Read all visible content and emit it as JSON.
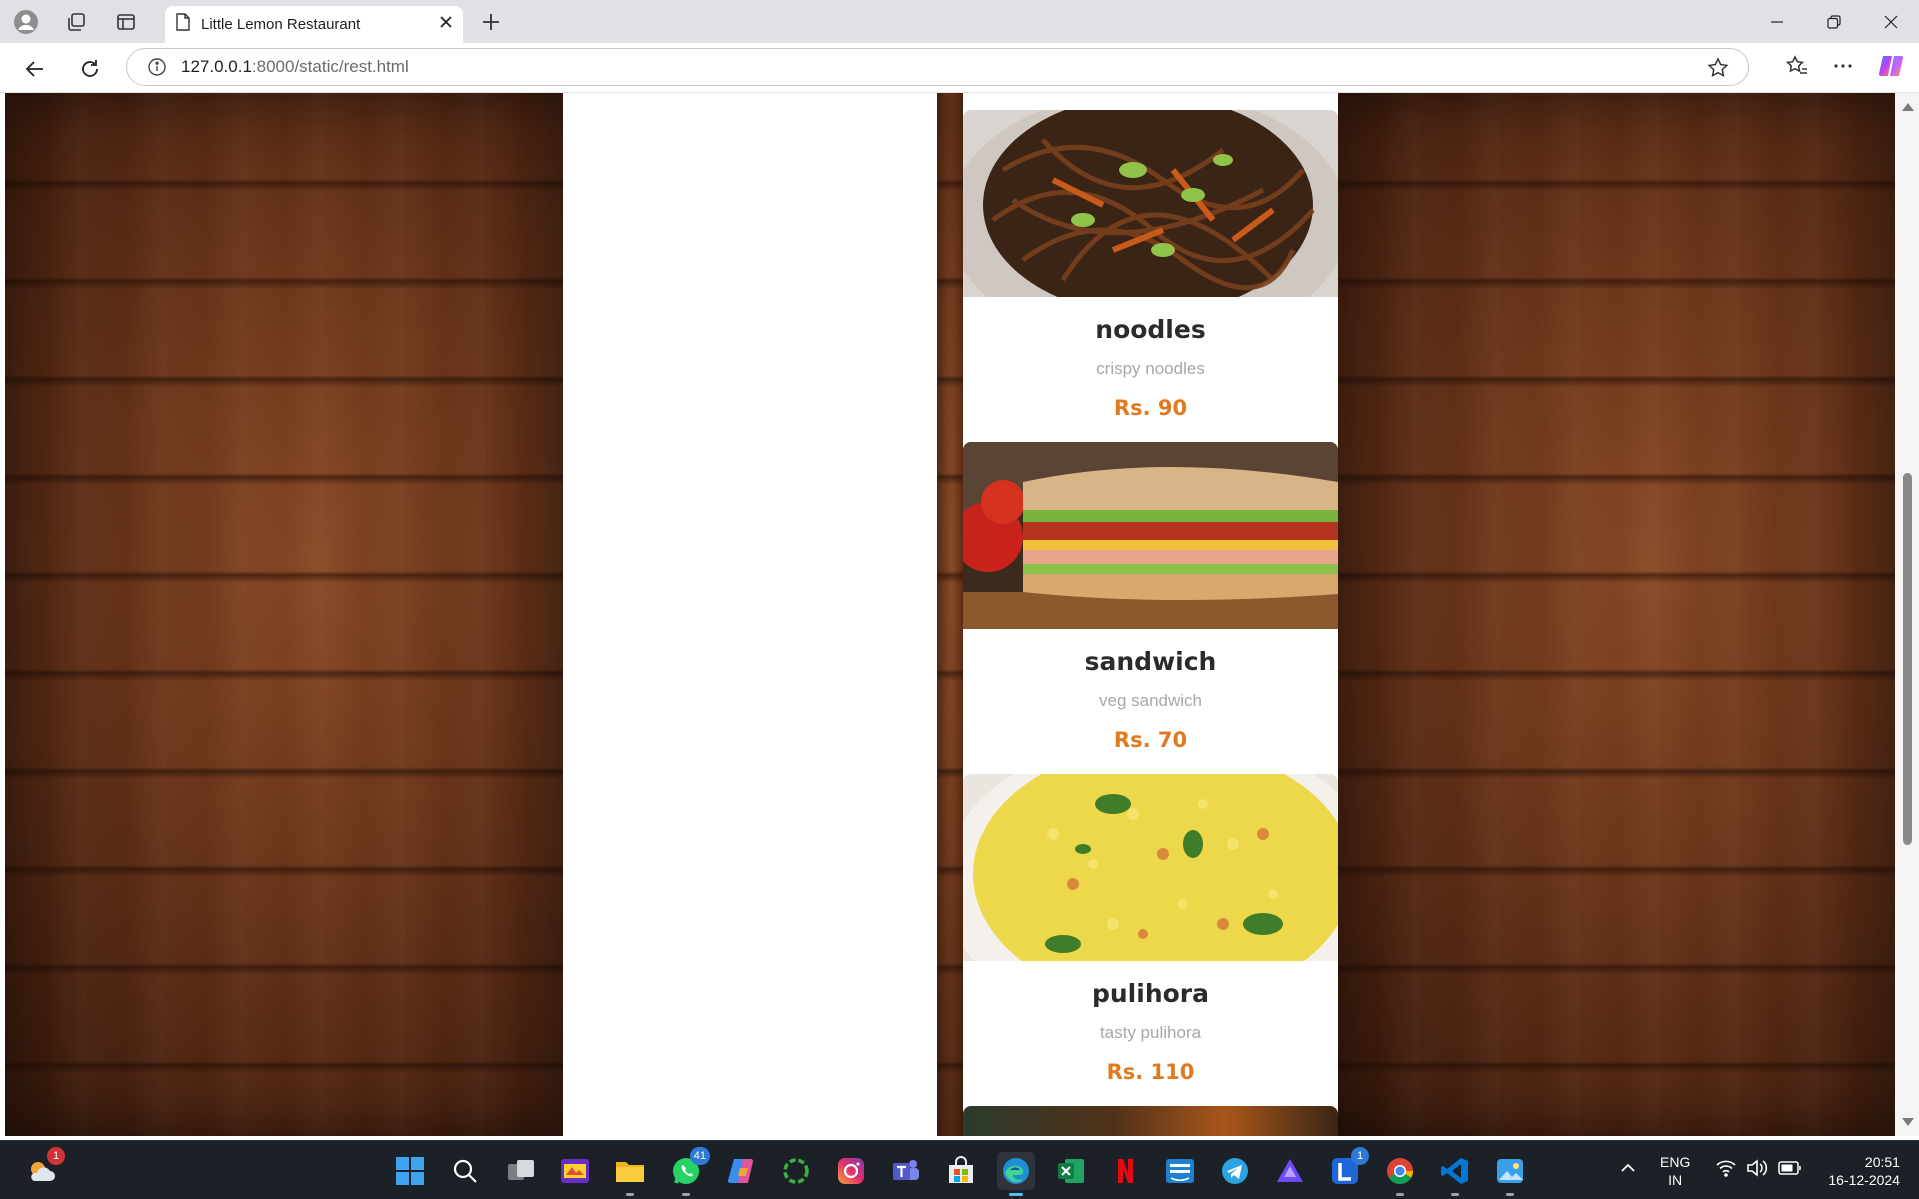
{
  "browser": {
    "tab_title": "Little Lemon Restaurant",
    "url_host": "127.0.0.1",
    "url_path": ":8000/static/rest.html"
  },
  "menu": {
    "items": [
      {
        "name": "noodles",
        "description": "crispy noodles",
        "price": "Rs. 90",
        "image": "noodles-photo"
      },
      {
        "name": "sandwich",
        "description": "veg sandwich",
        "price": "Rs. 70",
        "image": "sandwich-photo"
      },
      {
        "name": "pulihora",
        "description": "tasty pulihora",
        "price": "Rs. 110",
        "image": "pulihora-photo"
      }
    ]
  },
  "colors": {
    "price": "#e07a1e",
    "item_name": "#2b2b2b",
    "description": "#a7a7a7",
    "wood": "#6b3519"
  },
  "taskbar": {
    "weather_badge": "1",
    "whatsapp_badge": "41",
    "l_app_badge": "1",
    "lang": "ENG",
    "region": "IN",
    "time": "20:51",
    "date": "16-12-2024",
    "apps": [
      "weather-icon",
      "windows-start-icon",
      "search-icon",
      "task-view-icon",
      "game-icon",
      "file-explorer-icon",
      "whatsapp-icon",
      "copilot-icon",
      "circle-app-icon",
      "instagram-icon",
      "teams-icon",
      "microsoft-store-icon",
      "edge-icon",
      "excel-icon",
      "netflix-icon",
      "prime-video-icon",
      "telegram-icon",
      "proton-vpn-icon",
      "l-app-icon",
      "chrome-icon",
      "vscode-icon",
      "photos-icon"
    ]
  }
}
